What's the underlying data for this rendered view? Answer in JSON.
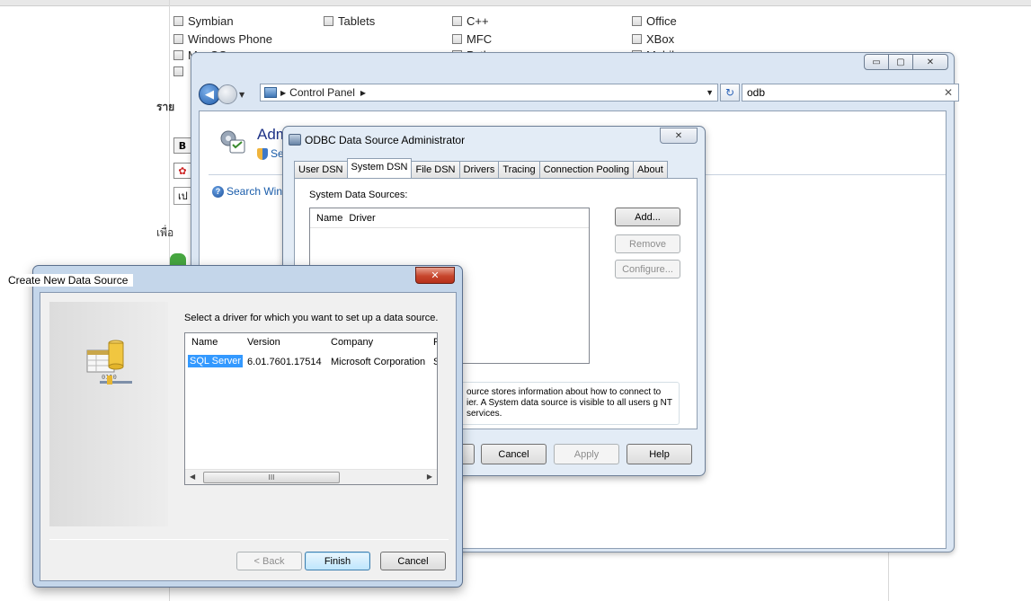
{
  "web_page": {
    "checkboxes": [
      {
        "label": "Symbian"
      },
      {
        "label": "Tablets"
      },
      {
        "label": "C++"
      },
      {
        "label": "Office"
      },
      {
        "label": "Windows Phone"
      },
      {
        "label": "MFC"
      },
      {
        "label": "XBox"
      },
      {
        "label": "MacOS"
      },
      {
        "label": "Python"
      },
      {
        "label": "Mobile"
      }
    ],
    "fragments": {
      "rai": "ราย",
      "b_btn": "B",
      "pen": "เป",
      "phuea": "เพื่อ"
    }
  },
  "explorer": {
    "address_path": "Control Panel",
    "search_value": "odb",
    "heading": "Adm",
    "subtitle": "Set",
    "search_windows": "Search Win",
    "caption_buttons": {
      "minimize": "▭",
      "maximize": "▢",
      "close": "✕"
    }
  },
  "odbc_dialog": {
    "title": "ODBC Data Source Administrator",
    "tabs": [
      "User DSN",
      "System DSN",
      "File DSN",
      "Drivers",
      "Tracing",
      "Connection Pooling",
      "About"
    ],
    "active_tab": "System DSN",
    "list_label": "System Data Sources:",
    "columns": [
      "Name",
      "Driver"
    ],
    "side_buttons": {
      "add": "Add...",
      "remove": "Remove",
      "configure": "Configure..."
    },
    "info_text": "ource stores information about how to connect to ier.  A System data source is visible to all users g NT services.",
    "buttons": {
      "ok": "",
      "cancel": "Cancel",
      "apply": "Apply",
      "help": "Help"
    }
  },
  "create_dialog": {
    "title": "Create New Data Source",
    "prompt": "Select a driver for which you want to set up a data source.",
    "columns": [
      "Name",
      "Version",
      "Company",
      "F"
    ],
    "rows": [
      {
        "name": "SQL Server",
        "version": "6.01.7601.17514",
        "company": "Microsoft Corporation",
        "extra": "S"
      }
    ],
    "scroll_thumb": "III",
    "buttons": {
      "back": "< Back",
      "finish": "Finish",
      "cancel": "Cancel"
    }
  }
}
